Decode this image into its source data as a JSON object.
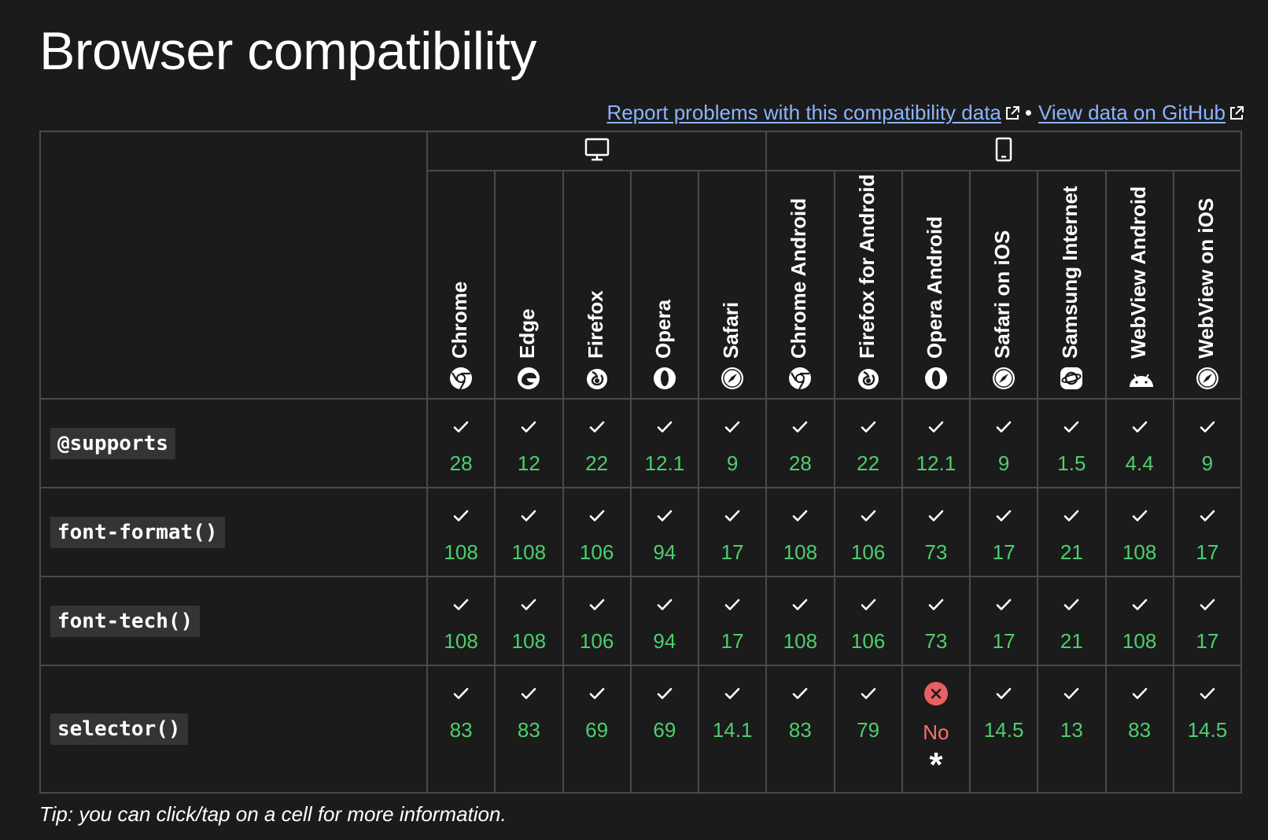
{
  "page": {
    "title": "Browser compatibility"
  },
  "links": {
    "report": "Report problems with this compatibility data",
    "separator": "•",
    "github": "View data on GitHub"
  },
  "platforms": [
    {
      "name": "desktop",
      "icon": "desktop-icon",
      "span": 5
    },
    {
      "name": "mobile",
      "icon": "mobile-icon",
      "span": 7
    }
  ],
  "browsers": [
    {
      "name": "Chrome",
      "icon": "chrome-icon"
    },
    {
      "name": "Edge",
      "icon": "edge-icon"
    },
    {
      "name": "Firefox",
      "icon": "firefox-icon"
    },
    {
      "name": "Opera",
      "icon": "opera-icon"
    },
    {
      "name": "Safari",
      "icon": "safari-icon"
    },
    {
      "name": "Chrome Android",
      "icon": "chrome-icon"
    },
    {
      "name": "Firefox for Android",
      "icon": "firefox-icon"
    },
    {
      "name": "Opera Android",
      "icon": "opera-icon"
    },
    {
      "name": "Safari on iOS",
      "icon": "safari-icon"
    },
    {
      "name": "Samsung Internet",
      "icon": "samsung-internet-icon"
    },
    {
      "name": "WebView Android",
      "icon": "android-icon"
    },
    {
      "name": "WebView on iOS",
      "icon": "safari-icon"
    }
  ],
  "features": [
    {
      "name": "@supports",
      "support": [
        {
          "status": "yes",
          "version": "28"
        },
        {
          "status": "yes",
          "version": "12"
        },
        {
          "status": "yes",
          "version": "22"
        },
        {
          "status": "yes",
          "version": "12.1"
        },
        {
          "status": "yes",
          "version": "9"
        },
        {
          "status": "yes",
          "version": "28"
        },
        {
          "status": "yes",
          "version": "22"
        },
        {
          "status": "yes",
          "version": "12.1"
        },
        {
          "status": "yes",
          "version": "9"
        },
        {
          "status": "yes",
          "version": "1.5"
        },
        {
          "status": "yes",
          "version": "4.4"
        },
        {
          "status": "yes",
          "version": "9"
        }
      ]
    },
    {
      "name": "font-format()",
      "support": [
        {
          "status": "yes",
          "version": "108"
        },
        {
          "status": "yes",
          "version": "108"
        },
        {
          "status": "yes",
          "version": "106"
        },
        {
          "status": "yes",
          "version": "94"
        },
        {
          "status": "yes",
          "version": "17"
        },
        {
          "status": "yes",
          "version": "108"
        },
        {
          "status": "yes",
          "version": "106"
        },
        {
          "status": "yes",
          "version": "73"
        },
        {
          "status": "yes",
          "version": "17"
        },
        {
          "status": "yes",
          "version": "21"
        },
        {
          "status": "yes",
          "version": "108"
        },
        {
          "status": "yes",
          "version": "17"
        }
      ]
    },
    {
      "name": "font-tech()",
      "support": [
        {
          "status": "yes",
          "version": "108"
        },
        {
          "status": "yes",
          "version": "108"
        },
        {
          "status": "yes",
          "version": "106"
        },
        {
          "status": "yes",
          "version": "94"
        },
        {
          "status": "yes",
          "version": "17"
        },
        {
          "status": "yes",
          "version": "108"
        },
        {
          "status": "yes",
          "version": "106"
        },
        {
          "status": "yes",
          "version": "73"
        },
        {
          "status": "yes",
          "version": "17"
        },
        {
          "status": "yes",
          "version": "21"
        },
        {
          "status": "yes",
          "version": "108"
        },
        {
          "status": "yes",
          "version": "17"
        }
      ]
    },
    {
      "name": "selector()",
      "support": [
        {
          "status": "yes",
          "version": "83"
        },
        {
          "status": "yes",
          "version": "83"
        },
        {
          "status": "yes",
          "version": "69"
        },
        {
          "status": "yes",
          "version": "69"
        },
        {
          "status": "yes",
          "version": "14.1"
        },
        {
          "status": "yes",
          "version": "83"
        },
        {
          "status": "yes",
          "version": "79"
        },
        {
          "status": "no",
          "version": "No",
          "note": "*"
        },
        {
          "status": "yes",
          "version": "14.5"
        },
        {
          "status": "yes",
          "version": "13"
        },
        {
          "status": "yes",
          "version": "83"
        },
        {
          "status": "yes",
          "version": "14.5"
        }
      ]
    }
  ],
  "tip": "Tip: you can click/tap on a cell for more information.",
  "colors": {
    "background": "#1b1b1b",
    "border": "#4a4a4a",
    "link": "#8cb4ff",
    "supported": "#4ccf6d",
    "unsupported": "#ff7070",
    "code_bg": "#343434"
  }
}
